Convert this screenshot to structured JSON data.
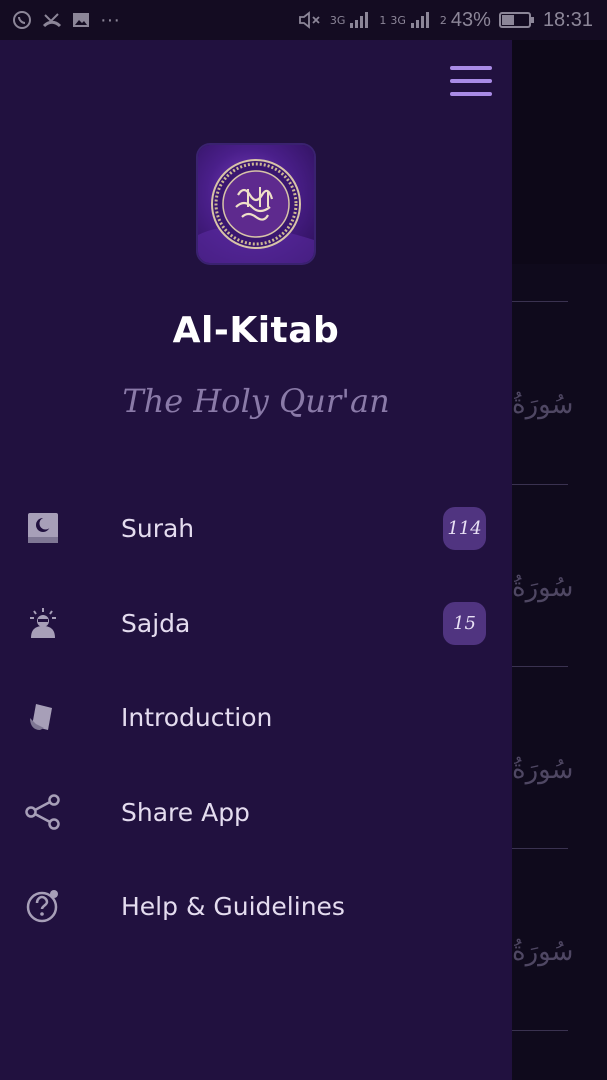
{
  "status_bar": {
    "battery": "43%",
    "time": "18:31",
    "network_1": "3G",
    "network_2": "3G",
    "sim_1": "1",
    "sim_2": "2",
    "more": "···"
  },
  "drawer": {
    "app_title": "Al-Kitab",
    "app_subtitle": "The Holy Qur'an",
    "menu": [
      {
        "label": "Surah",
        "icon": "book-moon-icon",
        "badge": "114"
      },
      {
        "label": "Sajda",
        "icon": "prayer-person-icon",
        "badge": "15"
      },
      {
        "label": "Introduction",
        "icon": "hand-book-icon"
      },
      {
        "label": "Share App",
        "icon": "share-icon"
      },
      {
        "label": "Help & Guidelines",
        "icon": "help-icon"
      }
    ]
  },
  "background_list": {
    "items": [
      "سُورَةُ",
      "سُورَةُ",
      "سُورَةُ",
      "سُورَةُ"
    ]
  },
  "colors": {
    "drawer_bg": "#21113f",
    "accent": "#a98be6",
    "badge_bg": "#503480"
  }
}
